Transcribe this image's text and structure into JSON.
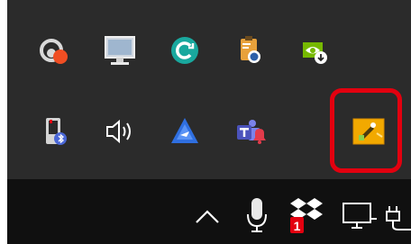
{
  "overflow": {
    "row1": [
      {
        "name": "cloud-sync-icon"
      },
      {
        "name": "monitor-display-icon"
      },
      {
        "name": "circular-arrow-app-icon"
      },
      {
        "name": "clipboard-security-icon"
      },
      {
        "name": "nvidia-download-icon"
      }
    ],
    "row2": [
      {
        "name": "bluetooth-device-icon"
      },
      {
        "name": "volume-speaker-icon"
      },
      {
        "name": "vpn-triangle-icon"
      },
      {
        "name": "teams-notification-icon"
      },
      {
        "name": "yellow-app-icon",
        "highlighted": true
      }
    ],
    "highlight_color": "#e3000f"
  },
  "taskbar": {
    "icons": [
      {
        "name": "chevron-up-icon"
      },
      {
        "name": "microphone-icon"
      },
      {
        "name": "dropbox-notification-icon",
        "badge": "1"
      },
      {
        "name": "network-monitor-icon"
      },
      {
        "name": "power-plug-icon"
      }
    ]
  },
  "colors": {
    "panel": "#2b2b2b",
    "taskbar": "#101010",
    "accent_red": "#e3000f",
    "teal": "#19a89e"
  }
}
